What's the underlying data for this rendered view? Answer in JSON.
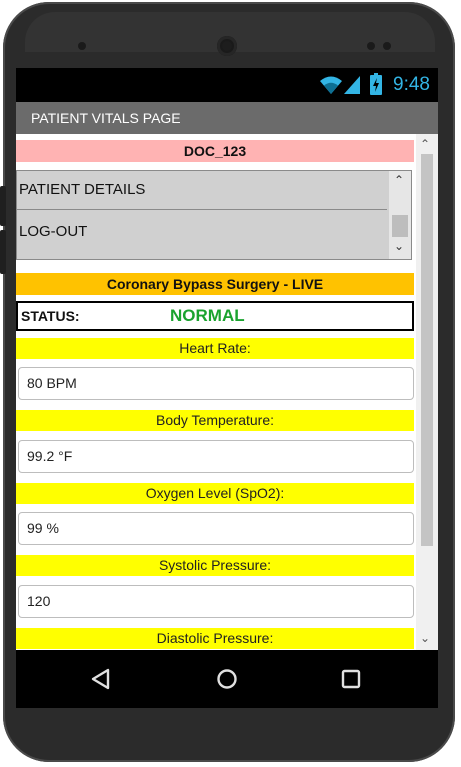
{
  "status_bar": {
    "time": "9:48"
  },
  "app": {
    "title": "PATIENT VITALS PAGE"
  },
  "doctor": {
    "id": "DOC_123"
  },
  "menu": {
    "items": [
      {
        "label": "PATIENT DETAILS"
      },
      {
        "label": "LOG-OUT"
      }
    ]
  },
  "surgery": {
    "title": "Coronary Bypass Surgery - LIVE"
  },
  "status": {
    "label": "STATUS:",
    "value": "NORMAL",
    "value_color": "#1aa32e"
  },
  "vitals": [
    {
      "label": "Heart Rate:",
      "value": "80 BPM"
    },
    {
      "label": "Body Temperature:",
      "value": "99.2 °F"
    },
    {
      "label": "Oxygen Level (SpO2):",
      "value": "99 %"
    },
    {
      "label": "Systolic Pressure:",
      "value": "120"
    },
    {
      "label": "Diastolic Pressure:",
      "value": ""
    }
  ],
  "icons": {
    "wifi": "wifi-icon",
    "signal": "cell-signal-icon",
    "battery": "battery-charging-icon",
    "back": "back-triangle-icon",
    "home": "home-circle-icon",
    "recents": "recents-square-icon"
  },
  "colors": {
    "doc_bar": "#ffb3b3",
    "surgery_bar": "#ffc200",
    "vital_label_bg": "#ffff00",
    "title_bar": "#6b6b6b",
    "accent": "#33b5e5"
  }
}
